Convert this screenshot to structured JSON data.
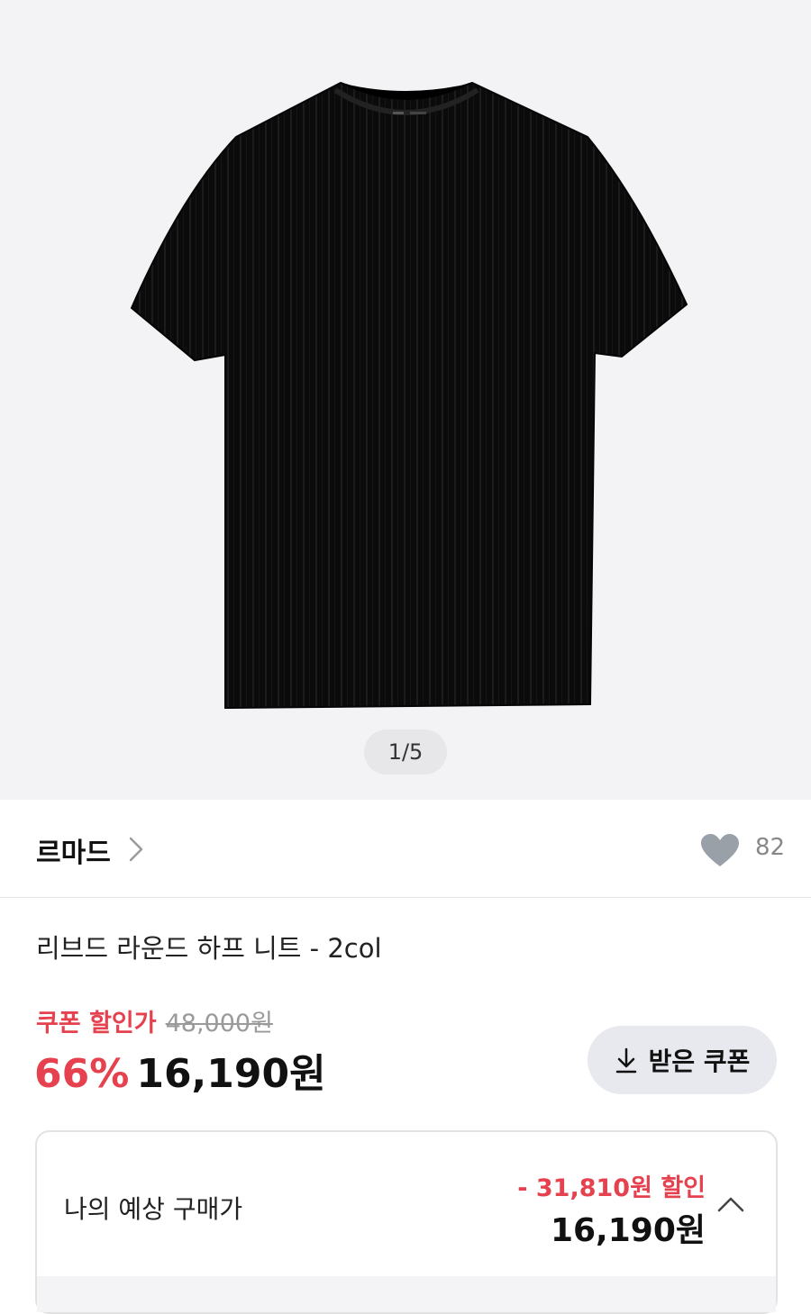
{
  "gallery": {
    "image": "black-ribbed-knit-tshirt",
    "page_indicator": "1/5",
    "background": "#f3f3f5"
  },
  "brand": {
    "name": "르마드",
    "likes": "82"
  },
  "product": {
    "title": "리브드 라운드 하프 니트 - 2col"
  },
  "pricing": {
    "coupon_label": "쿠폰 할인가",
    "original_price": "48,000원",
    "discount_rate": "66%",
    "sale_price": "16,190원",
    "coupon_button_label": "받은 쿠폰"
  },
  "estimate": {
    "label": "나의 예상 구매가",
    "discount_text": "- 31,810원 할인",
    "price": "16,190원"
  },
  "colors": {
    "accent_red": "#e5414e",
    "muted_gray": "#9a9a9a"
  }
}
